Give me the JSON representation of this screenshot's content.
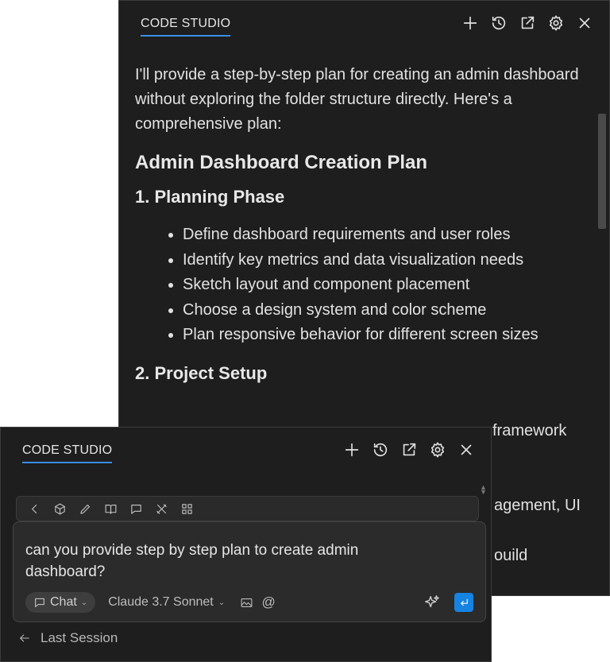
{
  "back_panel": {
    "title": "CODE STUDIO",
    "intro": "I'll provide a step-by-step plan for creating an admin dashboard without exploring the folder structure directly. Here's a comprehensive plan:",
    "heading": "Admin Dashboard Creation Plan",
    "section1_title": "1. Planning Phase",
    "section1_items": [
      "Define dashboard requirements and user roles",
      "Identify key metrics and data visualization needs",
      "Sketch layout and component placement",
      "Choose a design system and color scheme",
      "Plan responsive behavior for different screen sizes"
    ],
    "section2_title": "2. Project Setup",
    "peek_lines": [
      "framework",
      "agement, UI",
      "ouild"
    ]
  },
  "front_panel": {
    "title": "CODE STUDIO",
    "prompt": "can you provide step by step plan to create admin dashboard?",
    "mode_label": "Chat",
    "model_label": "Claude 3.7 Sonnet",
    "at_symbol": "@",
    "last_session_label": "Last Session"
  }
}
